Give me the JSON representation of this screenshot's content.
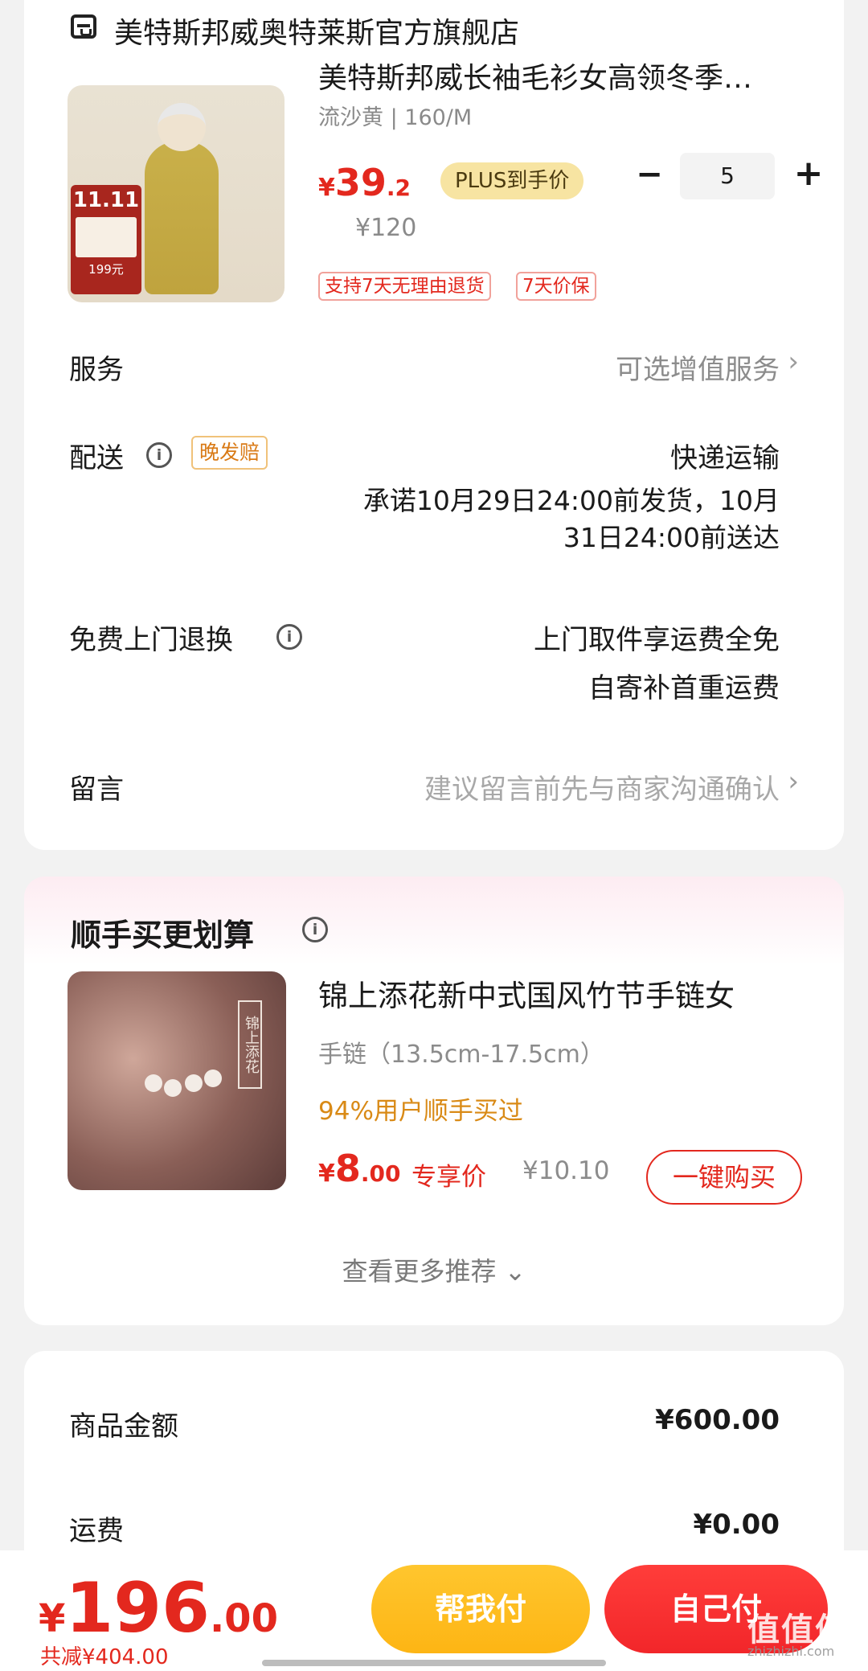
{
  "store": {
    "name": "美特斯邦威奥特莱斯官方旗舰店",
    "icon": "store-icon"
  },
  "product": {
    "title": "美特斯邦威长袖毛衫女高领冬季…",
    "sku": "流沙黄 | 160/M",
    "price_symbol": "¥",
    "price_int": "39",
    "price_dec": ".2",
    "plus_tag": "PLUS到手价",
    "quantity": "5",
    "minus_label": "−",
    "plus_label": "+",
    "original_price": "¥120",
    "tags": [
      "支持7天无理由退货",
      "7天价保"
    ],
    "image_badge": {
      "top": "11.11",
      "price": "199元"
    }
  },
  "service": {
    "label": "服务",
    "value": "可选增值服务",
    "chevron": "›"
  },
  "delivery": {
    "label": "配送",
    "late_tag": "晚发赔",
    "method": "快递运输",
    "promise_line1": "承诺10月29日24:00前发货，10月",
    "promise_line2": "31日24:00前送达"
  },
  "return": {
    "label": "免费上门退换",
    "line1": "上门取件享运费全免",
    "line2": "自寄补首重运费"
  },
  "message": {
    "label": "留言",
    "placeholder": "建议留言前先与商家沟通确认",
    "chevron": "›"
  },
  "recommend": {
    "title": "顺手买更划算",
    "name": "锦上添花新中式国风竹节手链女",
    "spec": "手链（13.5cm-17.5cm）",
    "bought": "94%用户顺手买过",
    "price_symbol": "¥",
    "price_int": "8",
    "price_dec": ".00",
    "exclusive": "专享价",
    "original_price": "¥10.10",
    "buy_button": "一键购买",
    "see_more": "查看更多推荐 ⌄",
    "image_text": "锦上添花"
  },
  "summary": {
    "goods_label": "商品金额",
    "goods_value": "¥600.00",
    "shipping_label": "运费",
    "shipping_value": "¥0.00"
  },
  "bottom": {
    "price_symbol": "¥",
    "price_int": "196",
    "price_dec": ".00",
    "saved": "共减¥404.00",
    "help_pay": "帮我付",
    "self_pay": "自己付",
    "watermark": "值值值",
    "watermark_sub": "zhizhizhi.com"
  },
  "colors": {
    "accent_red": "#e3281e",
    "yellow_button": "#fdb514",
    "red_button": "#f2262a",
    "plus_tag_bg": "#f7e4a2",
    "bought_text": "#d98a16"
  }
}
